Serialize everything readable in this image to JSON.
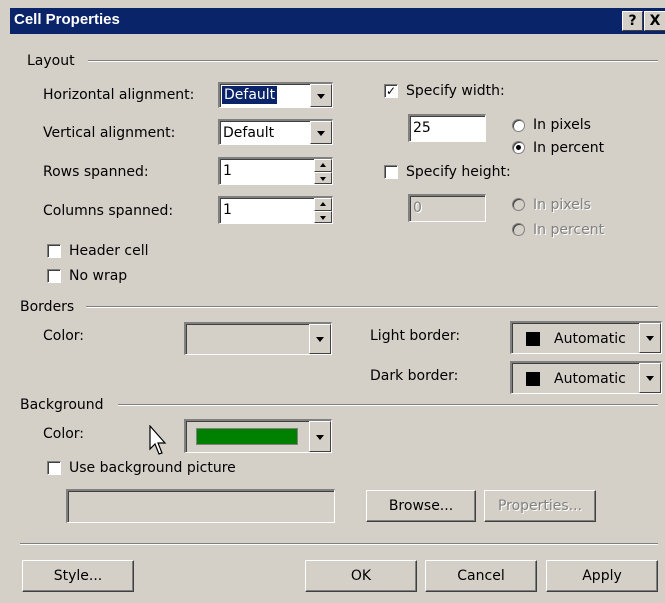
{
  "window": {
    "title": "Cell Properties",
    "help_label": "?",
    "close_label": "X"
  },
  "layout": {
    "group_label": "Layout",
    "horizontal_alignment_label": "Horizontal alignment:",
    "horizontal_alignment_value": "Default",
    "vertical_alignment_label": "Vertical alignment:",
    "vertical_alignment_value": "Default",
    "rows_spanned_label": "Rows spanned:",
    "rows_spanned_value": "1",
    "columns_spanned_label": "Columns spanned:",
    "columns_spanned_value": "1",
    "header_cell_label": "Header cell",
    "header_cell_checked": false,
    "no_wrap_label": "No wrap",
    "no_wrap_checked": false,
    "specify_width_label": "Specify width:",
    "specify_width_checked": true,
    "width_value": "25",
    "width_in_pixels_label": "In pixels",
    "width_in_percent_label": "In percent",
    "width_unit_selected": "In percent",
    "specify_height_label": "Specify height:",
    "specify_height_checked": false,
    "height_value": "0",
    "height_in_pixels_label": "In pixels",
    "height_in_percent_label": "In percent"
  },
  "borders": {
    "group_label": "Borders",
    "color_label": "Color:",
    "color_value": "",
    "light_border_label": "Light border:",
    "light_border_value": "Automatic",
    "dark_border_label": "Dark border:",
    "dark_border_value": "Automatic"
  },
  "background": {
    "group_label": "Background",
    "color_label": "Color:",
    "color_swatch": "#008000",
    "use_picture_label": "Use background picture",
    "use_picture_checked": false,
    "picture_path": "",
    "browse_label": "Browse...",
    "properties_label": "Properties..."
  },
  "buttons": {
    "style_label": "Style...",
    "ok_label": "OK",
    "cancel_label": "Cancel",
    "apply_label": "Apply"
  },
  "colors": {
    "title_bar": "#0a246a",
    "dialog_face": "#d4d0c8",
    "selection": "#0a246a"
  }
}
